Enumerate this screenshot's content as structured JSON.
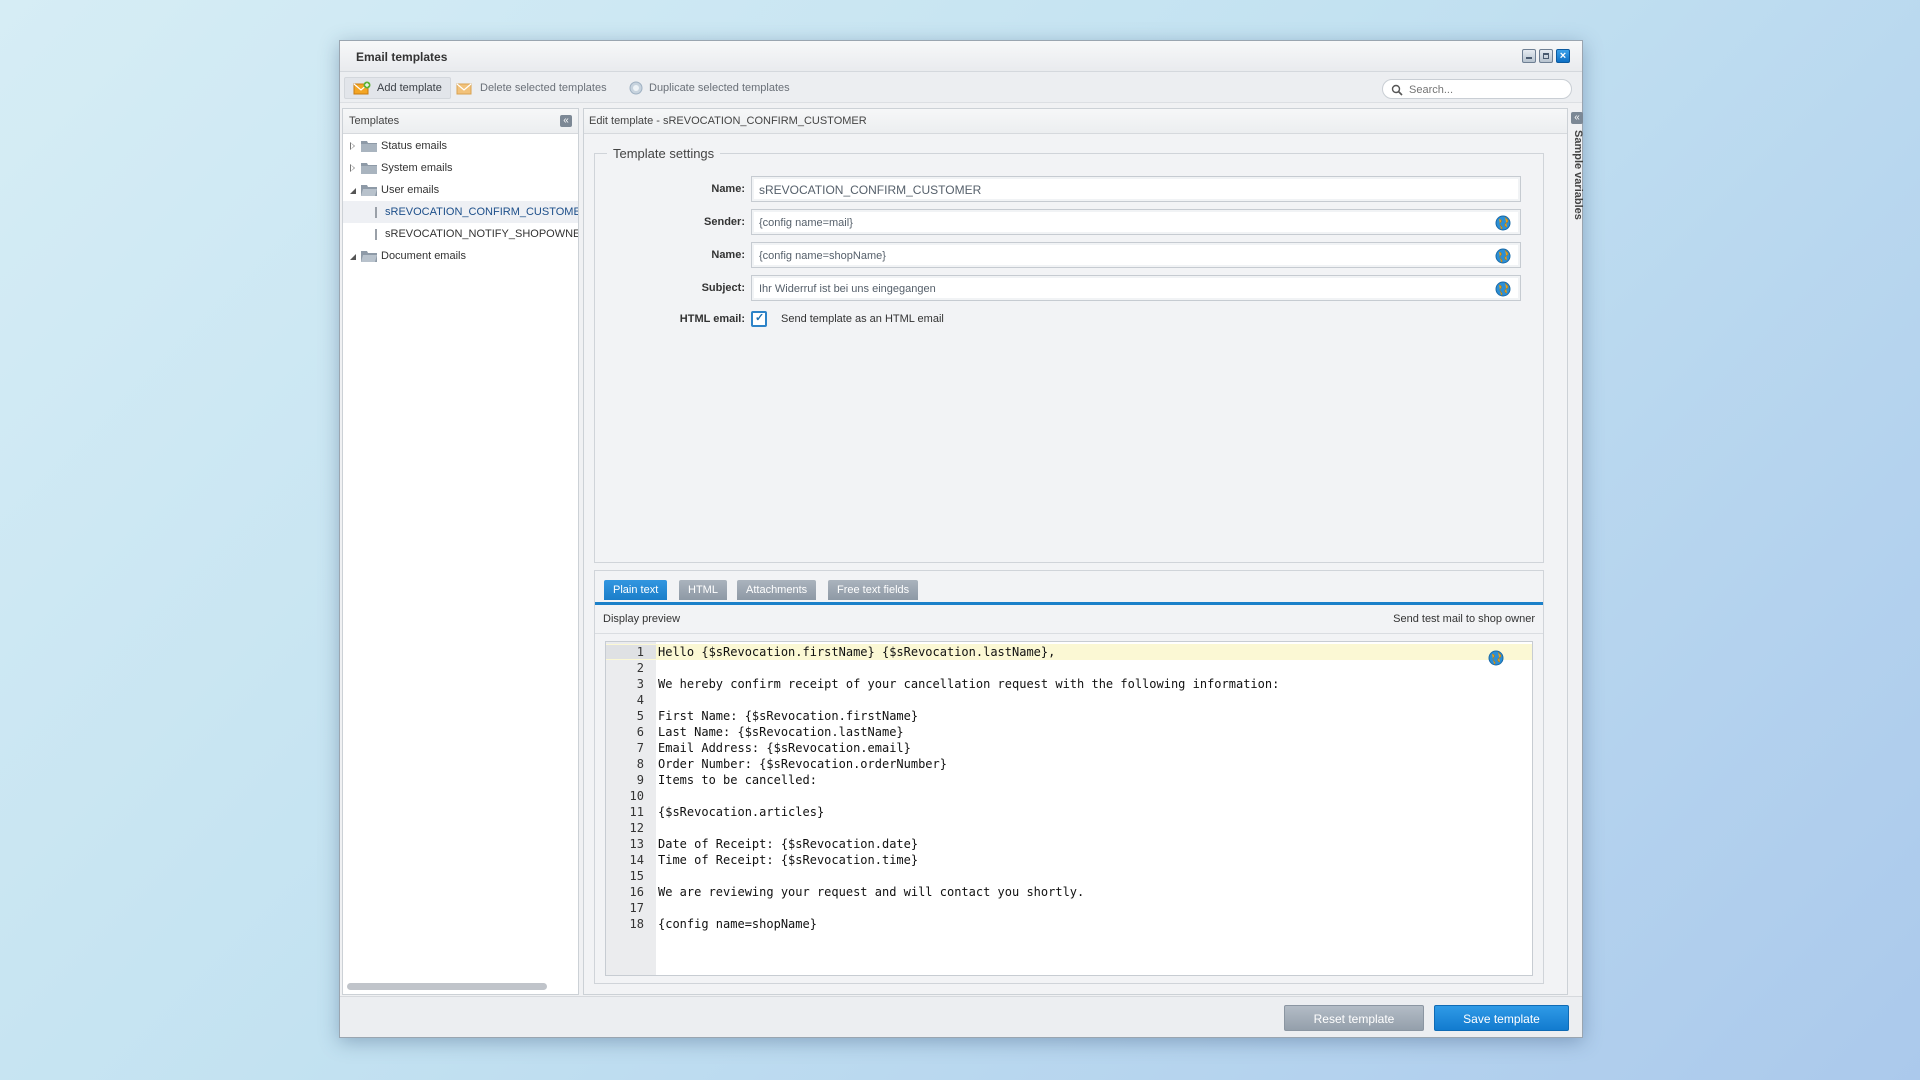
{
  "window": {
    "title": "Email templates"
  },
  "toolbar": {
    "add_label": "Add template",
    "delete_label": "Delete selected templates",
    "duplicate_label": "Duplicate selected templates",
    "search_placeholder": "Search..."
  },
  "tree": {
    "title": "Templates",
    "items": [
      {
        "label": "Status emails",
        "type": "folder",
        "state": "closed"
      },
      {
        "label": "System emails",
        "type": "folder",
        "state": "closed"
      },
      {
        "label": "User emails",
        "type": "folder",
        "state": "open"
      },
      {
        "label": "sREVOCATION_CONFIRM_CUSTOMER",
        "type": "template",
        "selected": true
      },
      {
        "label": "sREVOCATION_NOTIFY_SHOPOWNER",
        "type": "template"
      },
      {
        "label": "Document emails",
        "type": "folder",
        "state": "open"
      }
    ]
  },
  "editor": {
    "header": "Edit template - sREVOCATION_CONFIRM_CUSTOMER",
    "settings_title": "Template settings",
    "fields": {
      "name": {
        "label": "Name:",
        "value": "sREVOCATION_CONFIRM_CUSTOMER"
      },
      "sender": {
        "label": "Sender:",
        "value": "{config name=mail}"
      },
      "from_name": {
        "label": "Name:",
        "value": "{config name=shopName}"
      },
      "subject": {
        "label": "Subject:",
        "value": "Ihr Widerruf ist bei uns eingegangen"
      },
      "html_email": {
        "label": "HTML email:",
        "checkbox_label": "Send template as an HTML email",
        "checked": true
      }
    },
    "tabs": [
      "Plain text",
      "HTML",
      "Attachments",
      "Free text fields"
    ],
    "active_tab": "Plain text",
    "display_preview": "Display preview",
    "send_test": "Send test mail to shop owner",
    "code_lines": [
      "Hello {$sRevocation.firstName} {$sRevocation.lastName},",
      "",
      "We hereby confirm receipt of your cancellation request with the following information:",
      "",
      "First Name: {$sRevocation.firstName}",
      "Last Name: {$sRevocation.lastName}",
      "Email Address: {$sRevocation.email}",
      "Order Number: {$sRevocation.orderNumber}",
      "Items to be cancelled:",
      "",
      "{$sRevocation.articles}",
      "",
      "Date of Receipt: {$sRevocation.date}",
      "Time of Receipt: {$sRevocation.time}",
      "",
      "We are reviewing your request and will contact you shortly.",
      "",
      "{config name=shopName}"
    ]
  },
  "sidebar": {
    "label": "Sample variables"
  },
  "footer": {
    "reset_label": "Reset template",
    "save_label": "Save template"
  },
  "colors": {
    "accent": "#1b80c9",
    "tab_inactive": "#95a0ac",
    "highlight_line": "#fbf8d4"
  }
}
